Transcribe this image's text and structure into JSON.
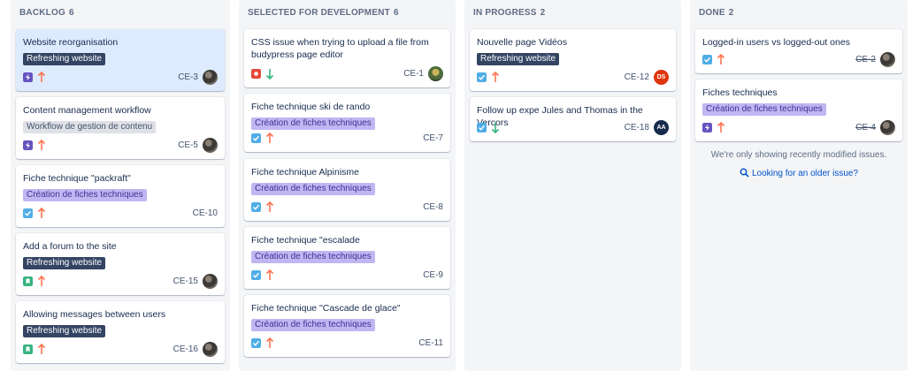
{
  "colors": {
    "story": "#36b37e",
    "task": "#4fade6",
    "epic": "#6554c0",
    "bug": "#e5493a",
    "priority_high": "#ff7452",
    "priority_low": "#36b37e"
  },
  "columns": [
    {
      "title": "BACKLOG",
      "count": "6",
      "cards": [
        {
          "title": "Website reorganisation",
          "epic": "Refreshing website",
          "key": "CE-3",
          "type": "epic-icon",
          "priority": "arrow-up-icon"
        },
        {
          "title": "Content management workflow",
          "epic": "Workflow de gestion de contenu",
          "key": "CE-5",
          "type": "epic-icon",
          "priority": "arrow-up-icon"
        },
        {
          "title": "Fiche technique \"packraft\"",
          "epic": "Création de fiches techniques",
          "key": "CE-10",
          "type": "task-icon",
          "priority": "arrow-up-icon"
        },
        {
          "title": "Add a forum to the site",
          "epic": "Refreshing website",
          "key": "CE-15",
          "type": "story-icon",
          "priority": "arrow-up-icon"
        },
        {
          "title": "Allowing messages between users",
          "epic": "Refreshing website",
          "key": "CE-16",
          "type": "story-icon",
          "priority": "arrow-up-icon"
        }
      ]
    },
    {
      "title": "SELECTED FOR DEVELOPMENT",
      "count": "6",
      "cards": [
        {
          "title": "CSS issue when trying to upload a file from budypress page editor",
          "key": "CE-1",
          "type": "bug-icon",
          "priority": "arrow-down-icon"
        },
        {
          "title": "Fiche technique ski de rando",
          "epic": "Création de fiches techniques",
          "key": "CE-7",
          "type": "task-icon",
          "priority": "arrow-up-icon"
        },
        {
          "title": "Fiche technique Alpinisme",
          "epic": "Création de fiches techniques",
          "key": "CE-8",
          "type": "task-icon",
          "priority": "arrow-up-icon"
        },
        {
          "title": "Fiche technique \"escalade",
          "epic": "Création de fiches techniques",
          "key": "CE-9",
          "type": "task-icon",
          "priority": "arrow-up-icon"
        },
        {
          "title": "Fiche technique \"Cascade de glace\"",
          "epic": "Création de fiches techniques",
          "key": "CE-11",
          "type": "task-icon",
          "priority": "arrow-up-icon"
        }
      ]
    },
    {
      "title": "IN PROGRESS",
      "count": "2",
      "cards": [
        {
          "title": "Nouvelle page Vidéos",
          "epic": "Refreshing website",
          "key": "CE-12",
          "type": "task-icon",
          "priority": "arrow-up-icon",
          "avatar": "DS"
        },
        {
          "title": "Follow up expe Jules and Thomas in the Vercors",
          "key": "CE-18",
          "type": "task-icon",
          "priority": "arrow-down-icon",
          "avatar": "AA"
        }
      ]
    },
    {
      "title": "DONE",
      "count": "2",
      "cards": [
        {
          "title": "Logged-in users vs logged-out ones",
          "key": "CE-2",
          "type": "task-icon",
          "priority": "arrow-up-icon"
        },
        {
          "title": "Fiches techniques",
          "epic": "Création de fiches techniques",
          "key": "CE-4",
          "type": "epic-icon",
          "priority": "arrow-up-icon"
        }
      ],
      "empty_message": "We're only showing recently modified issues.",
      "older_link": "Looking for an older issue?"
    }
  ]
}
